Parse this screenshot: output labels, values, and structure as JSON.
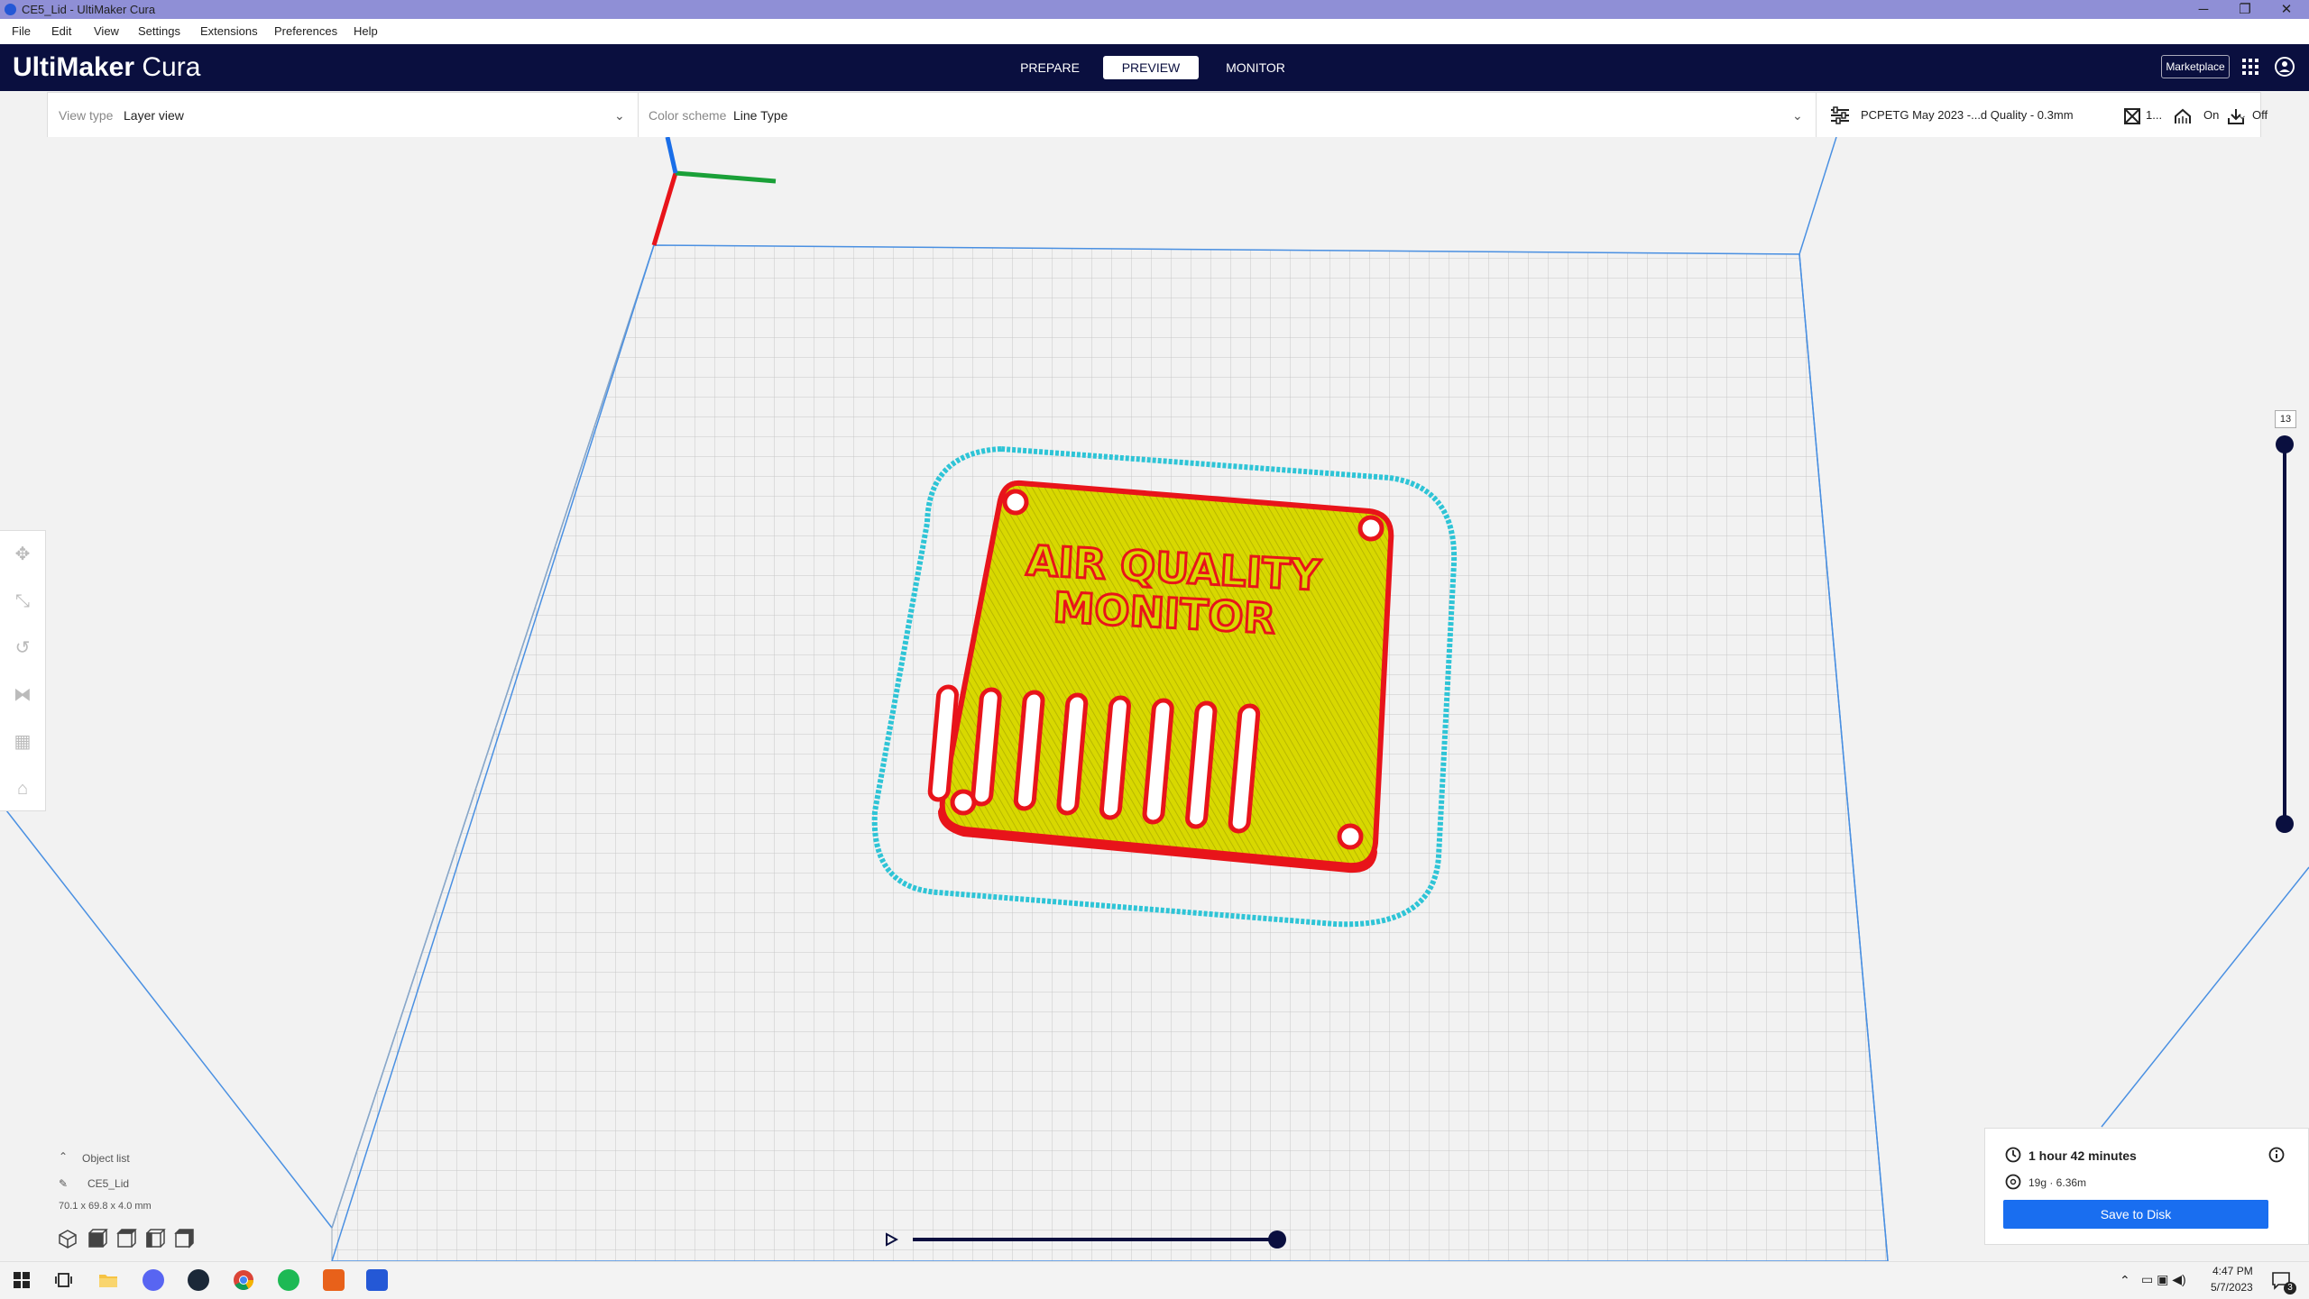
{
  "window": {
    "title": "CE5_Lid - UltiMaker Cura",
    "controls": {
      "minimize": "─",
      "maximize": "❐",
      "close": "✕"
    }
  },
  "menu": [
    "File",
    "Edit",
    "View",
    "Settings",
    "Extensions",
    "Preferences",
    "Help"
  ],
  "header": {
    "logo_bold": "UltiMaker",
    "logo_light": "Cura",
    "stages": [
      "PREPARE",
      "PREVIEW",
      "MONITOR"
    ],
    "active_stage": "PREVIEW",
    "marketplace": "Marketplace"
  },
  "viewbar": {
    "view_type_label": "View type",
    "view_type_value": "Layer view",
    "color_scheme_label": "Color scheme",
    "color_scheme_value": "Line Type",
    "profile": "PCPETG May 2023 -...d Quality - 0.3mm",
    "infill": "1...",
    "support": "On",
    "adhesion": "Off"
  },
  "model": {
    "line1": "AIR QUALITY",
    "line2": "MONITOR"
  },
  "layer_slider": {
    "current_layer": "13"
  },
  "object_list": {
    "toggle": "Object list",
    "object_name": "CE5_Lid",
    "dimensions": "70.1 x 69.8 x 4.0 mm"
  },
  "print_info": {
    "time": "1 hour 42 minutes",
    "material": "19g · 6.36m",
    "save": "Save to Disk"
  },
  "taskbar": {
    "time": "4:47 PM",
    "date": "5/7/2023",
    "notifications": "3"
  },
  "colors": {
    "header": "#0a0f3f",
    "accent": "#196ef0",
    "wall": "#e8141a",
    "infill": "#d8d800",
    "skirt": "#2ec4d6"
  }
}
